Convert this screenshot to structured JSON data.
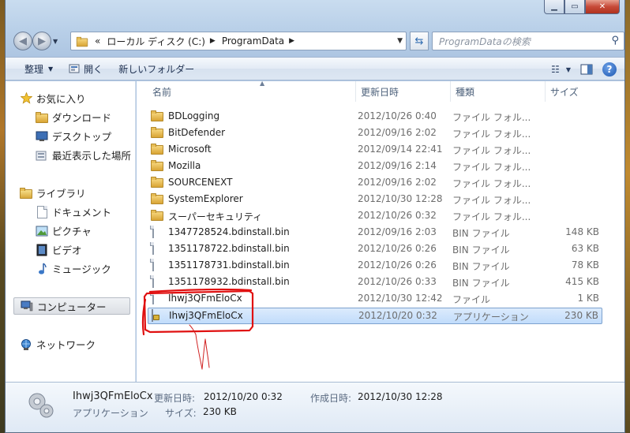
{
  "address": {
    "overflow_marker": "«",
    "segments": [
      "ローカル ディスク (C:)",
      "ProgramData"
    ]
  },
  "search": {
    "placeholder": "ProgramDataの検索"
  },
  "toolbar": {
    "organize": "整理",
    "open": "開く",
    "new_folder": "新しいフォルダー"
  },
  "nav": {
    "favorites": "お気に入り",
    "downloads": "ダウンロード",
    "desktop": "デスクトップ",
    "recent": "最近表示した場所",
    "libraries": "ライブラリ",
    "documents": "ドキュメント",
    "pictures": "ピクチャ",
    "videos": "ビデオ",
    "music": "ミュージック",
    "computer": "コンピューター",
    "network": "ネットワーク"
  },
  "columns": {
    "name": "名前",
    "date": "更新日時",
    "type": "種類",
    "size": "サイズ"
  },
  "files": [
    {
      "name": "BDLogging",
      "date": "2012/10/26 0:40",
      "type": "ファイル フォル...",
      "size": "",
      "icon": "folder"
    },
    {
      "name": "BitDefender",
      "date": "2012/09/16 2:02",
      "type": "ファイル フォル...",
      "size": "",
      "icon": "folder"
    },
    {
      "name": "Microsoft",
      "date": "2012/09/14 22:41",
      "type": "ファイル フォル...",
      "size": "",
      "icon": "folder"
    },
    {
      "name": "Mozilla",
      "date": "2012/09/16 2:14",
      "type": "ファイル フォル...",
      "size": "",
      "icon": "folder"
    },
    {
      "name": "SOURCENEXT",
      "date": "2012/09/16 2:02",
      "type": "ファイル フォル...",
      "size": "",
      "icon": "folder"
    },
    {
      "name": "SystemExplorer",
      "date": "2012/10/30 12:28",
      "type": "ファイル フォル...",
      "size": "",
      "icon": "folder"
    },
    {
      "name": "スーパーセキュリティ",
      "date": "2012/10/26 0:32",
      "type": "ファイル フォル...",
      "size": "",
      "icon": "folder"
    },
    {
      "name": "1347728524.bdinstall.bin",
      "date": "2012/09/16 2:03",
      "type": "BIN ファイル",
      "size": "148 KB",
      "icon": "file"
    },
    {
      "name": "1351178722.bdinstall.bin",
      "date": "2012/10/26 0:26",
      "type": "BIN ファイル",
      "size": "63 KB",
      "icon": "file"
    },
    {
      "name": "1351178731.bdinstall.bin",
      "date": "2012/10/26 0:26",
      "type": "BIN ファイル",
      "size": "78 KB",
      "icon": "file"
    },
    {
      "name": "1351178932.bdinstall.bin",
      "date": "2012/10/26 0:33",
      "type": "BIN ファイル",
      "size": "415 KB",
      "icon": "file"
    },
    {
      "name": "Ihwj3QFmEloCx",
      "date": "2012/10/30 12:42",
      "type": "ファイル",
      "size": "1 KB",
      "icon": "file"
    },
    {
      "name": "Ihwj3QFmEloCx",
      "date": "2012/10/20 0:32",
      "type": "アプリケーション",
      "size": "230 KB",
      "icon": "application"
    }
  ],
  "details": {
    "name": "Ihwj3QFmEloCx",
    "modified_label": "更新日時:",
    "modified": "2012/10/20 0:32",
    "created_label": "作成日時:",
    "created": "2012/10/30 12:28",
    "type": "アプリケーション",
    "size_label": "サイズ:",
    "size": "230 KB"
  },
  "colors": {
    "annotation_red": "#e01010",
    "selection_fill": "#cfe4fc",
    "folder_yellow": "#e8c25a"
  }
}
